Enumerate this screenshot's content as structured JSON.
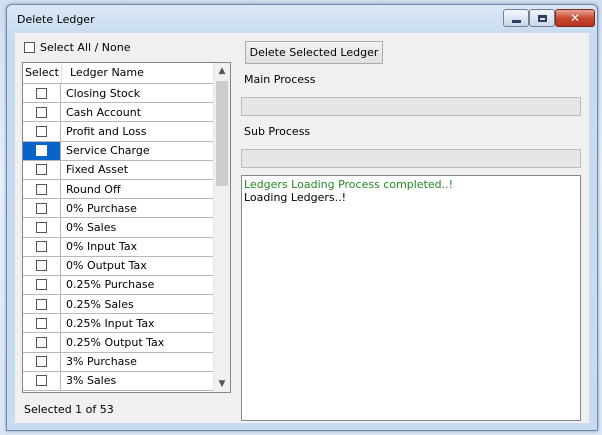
{
  "window": {
    "title": "Delete Ledger"
  },
  "select_all_label": "Select All / None",
  "delete_button_label": "Delete Selected Ledger",
  "main_process_label": "Main Process",
  "sub_process_label": "Sub Process",
  "list": {
    "headers": [
      "Select",
      "Ledger Name"
    ],
    "rows": [
      {
        "name": "Closing Stock",
        "checked": false,
        "selected": false
      },
      {
        "name": "Cash Account",
        "checked": false,
        "selected": false
      },
      {
        "name": "Profit and Loss",
        "checked": false,
        "selected": false
      },
      {
        "name": "Service Charge",
        "checked": false,
        "selected": true
      },
      {
        "name": "Fixed Asset",
        "checked": false,
        "selected": false
      },
      {
        "name": "Round Off",
        "checked": false,
        "selected": false
      },
      {
        "name": "0% Purchase",
        "checked": false,
        "selected": false
      },
      {
        "name": "0% Sales",
        "checked": false,
        "selected": false
      },
      {
        "name": "0% Input Tax",
        "checked": false,
        "selected": false
      },
      {
        "name": "0% Output Tax",
        "checked": false,
        "selected": false
      },
      {
        "name": "0.25% Purchase",
        "checked": false,
        "selected": false
      },
      {
        "name": "0.25% Sales",
        "checked": false,
        "selected": false
      },
      {
        "name": "0.25% Input Tax",
        "checked": false,
        "selected": false
      },
      {
        "name": "0.25% Output Tax",
        "checked": false,
        "selected": false
      },
      {
        "name": "3% Purchase",
        "checked": false,
        "selected": false
      },
      {
        "name": "3% Sales",
        "checked": false,
        "selected": false
      }
    ]
  },
  "status_text": "Selected 1 of 53",
  "log": {
    "line1": "Ledgers Loading Process completed..!",
    "line2": "Loading Ledgers..!"
  },
  "colors": {
    "selection": "#0a64c8",
    "log_success": "#228b22"
  }
}
